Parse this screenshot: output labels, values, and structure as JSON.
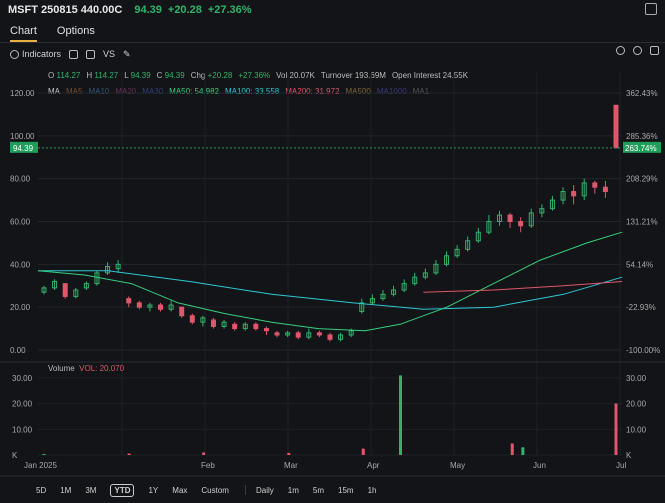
{
  "header": {
    "title": "MSFT 250815 440.00C",
    "price": "94.39",
    "change": "+20.28",
    "change_pct": "+27.36%"
  },
  "tabs": [
    "Chart",
    "Options"
  ],
  "toolbar": {
    "indicators": "Indicators",
    "vs": "VS"
  },
  "ohlc": {
    "o": "O",
    "o_val": "114.27",
    "h": "H",
    "h_val": "114.27",
    "l": "L",
    "l_val": "94.39",
    "c": "C",
    "c_val": "94.39",
    "chg": "Chg",
    "chg_val": "+20.28",
    "chg_pct": "+27.36%",
    "vol": "Vol",
    "vol_val": "20.07K",
    "turnover": "Turnover",
    "turnover_val": "193.69M",
    "oi": "Open Interest",
    "oi_val": "24.55K"
  },
  "ma_legend": [
    {
      "label": "MA",
      "color": "#c8c8c8"
    },
    {
      "label": "MA5",
      "color": "#7a4a2a"
    },
    {
      "label": "MA10",
      "color": "#2e5a7a"
    },
    {
      "label": "MA20",
      "color": "#6a2e5a"
    },
    {
      "label": "MA30",
      "color": "#2e3e7a"
    },
    {
      "label": "MA50: 54.982",
      "color": "#35d07f"
    },
    {
      "label": "MA100: 33.558",
      "color": "#2ec8d8"
    },
    {
      "label": "MA200: 31.972",
      "color": "#e0566a"
    },
    {
      "label": "MA500",
      "color": "#7a6a2e"
    },
    {
      "label": "MA1000",
      "color": "#3a3a7a"
    },
    {
      "label": "MA1",
      "color": "#555555"
    }
  ],
  "price_axis": [
    "120.00",
    "100.00",
    "80.00",
    "60.00",
    "40.00",
    "20.00",
    "0.00"
  ],
  "pct_axis": [
    "362.43%",
    "285.36%",
    "208.29%",
    "131.21%",
    "54.14%",
    "-22.93%",
    "-100.00%"
  ],
  "last_price_tag": "94.39",
  "last_pct_tag": "263.74%",
  "volume": {
    "label": "Volume",
    "vol_text": "VOL: 20.070",
    "left_axis": [
      "30.00",
      "20.00",
      "10.00",
      "K"
    ],
    "right_axis": [
      "30.00",
      "20.00",
      "10.00",
      "K"
    ]
  },
  "x_axis": [
    "Jan 2025",
    "Feb",
    "Mar",
    "Apr",
    "May",
    "Jun",
    "Jul"
  ],
  "periods": [
    "5D",
    "1M",
    "3M",
    "YTD",
    "1Y",
    "Max",
    "Custom"
  ],
  "selected_period": "YTD",
  "intervals": [
    "Daily",
    "1m",
    "5m",
    "15m",
    "1h"
  ],
  "colors": {
    "up": "#2fb36b",
    "down": "#e0566a",
    "ma50": "#35d07f",
    "ma100": "#2ec8d8",
    "ma200": "#e0566a"
  },
  "chart_data": {
    "type": "candlestick",
    "y_range": [
      0,
      120
    ],
    "volume_range_k": [
      0,
      30
    ],
    "candles": [
      {
        "x": "Jan 02",
        "o": 27,
        "c": 29,
        "h": 30,
        "l": 26
      },
      {
        "x": "Jan 06",
        "o": 29,
        "c": 32,
        "h": 33,
        "l": 28
      },
      {
        "x": "Jan 10",
        "o": 31,
        "c": 25,
        "h": 31,
        "l": 24
      },
      {
        "x": "Jan 14",
        "o": 25,
        "c": 28,
        "h": 29,
        "l": 24
      },
      {
        "x": "Jan 18",
        "o": 29,
        "c": 31,
        "h": 32,
        "l": 28
      },
      {
        "x": "Jan 22",
        "o": 31,
        "c": 36,
        "h": 37,
        "l": 30
      },
      {
        "x": "Jan 26",
        "o": 36,
        "c": 39,
        "h": 41,
        "l": 35
      },
      {
        "x": "Jan 30",
        "o": 38,
        "c": 40,
        "h": 42,
        "l": 36
      },
      {
        "x": "Feb 03",
        "o": 24,
        "c": 22,
        "h": 25,
        "l": 20
      },
      {
        "x": "Feb 07",
        "o": 22,
        "c": 20,
        "h": 23,
        "l": 19
      },
      {
        "x": "Feb 11",
        "o": 20,
        "c": 21,
        "h": 22,
        "l": 18
      },
      {
        "x": "Feb 15",
        "o": 21,
        "c": 19,
        "h": 22,
        "l": 18
      },
      {
        "x": "Feb 19",
        "o": 19,
        "c": 21,
        "h": 23,
        "l": 18
      },
      {
        "x": "Feb 23",
        "o": 20,
        "c": 16,
        "h": 20,
        "l": 15
      },
      {
        "x": "Feb 27",
        "o": 16,
        "c": 13,
        "h": 17,
        "l": 12
      },
      {
        "x": "Mar 03",
        "o": 13,
        "c": 15,
        "h": 16,
        "l": 11
      },
      {
        "x": "Mar 07",
        "o": 14,
        "c": 11,
        "h": 15,
        "l": 10
      },
      {
        "x": "Mar 11",
        "o": 11,
        "c": 13,
        "h": 14,
        "l": 10
      },
      {
        "x": "Mar 15",
        "o": 12,
        "c": 10,
        "h": 13,
        "l": 9
      },
      {
        "x": "Mar 19",
        "o": 10,
        "c": 12,
        "h": 13,
        "l": 9
      },
      {
        "x": "Mar 23",
        "o": 12,
        "c": 10,
        "h": 13,
        "l": 9
      },
      {
        "x": "Mar 27",
        "o": 10,
        "c": 9,
        "h": 11,
        "l": 7
      },
      {
        "x": "Mar 31",
        "o": 8,
        "c": 7,
        "h": 9,
        "l": 6
      },
      {
        "x": "Apr 04",
        "o": 7,
        "c": 8,
        "h": 9,
        "l": 6
      },
      {
        "x": "Apr 08",
        "o": 8,
        "c": 6,
        "h": 9,
        "l": 5
      },
      {
        "x": "Apr 12",
        "o": 6,
        "c": 8,
        "h": 10,
        "l": 5
      },
      {
        "x": "Apr 16",
        "o": 8,
        "c": 7,
        "h": 9,
        "l": 6
      },
      {
        "x": "Apr 20",
        "o": 7,
        "c": 5,
        "h": 8,
        "l": 4
      },
      {
        "x": "Apr 24",
        "o": 5,
        "c": 7,
        "h": 8,
        "l": 4
      },
      {
        "x": "Apr 28",
        "o": 7,
        "c": 9,
        "h": 10,
        "l": 6
      },
      {
        "x": "May 02",
        "o": 18,
        "c": 22,
        "h": 24,
        "l": 17
      },
      {
        "x": "May 06",
        "o": 22,
        "c": 24,
        "h": 26,
        "l": 21
      },
      {
        "x": "May 10",
        "o": 24,
        "c": 26,
        "h": 28,
        "l": 23
      },
      {
        "x": "May 14",
        "o": 26,
        "c": 28,
        "h": 30,
        "l": 25
      },
      {
        "x": "May 18",
        "o": 28,
        "c": 31,
        "h": 33,
        "l": 27
      },
      {
        "x": "May 22",
        "o": 31,
        "c": 34,
        "h": 36,
        "l": 30
      },
      {
        "x": "May 26",
        "o": 34,
        "c": 36,
        "h": 38,
        "l": 33
      },
      {
        "x": "May 30",
        "o": 36,
        "c": 40,
        "h": 42,
        "l": 35
      },
      {
        "x": "Jun 03",
        "o": 40,
        "c": 44,
        "h": 46,
        "l": 39
      },
      {
        "x": "Jun 07",
        "o": 44,
        "c": 47,
        "h": 49,
        "l": 43
      },
      {
        "x": "Jun 11",
        "o": 47,
        "c": 51,
        "h": 53,
        "l": 46
      },
      {
        "x": "Jun 15",
        "o": 51,
        "c": 55,
        "h": 57,
        "l": 50
      },
      {
        "x": "Jun 19",
        "o": 55,
        "c": 60,
        "h": 63,
        "l": 54
      },
      {
        "x": "Jun 23",
        "o": 60,
        "c": 63,
        "h": 65,
        "l": 58
      },
      {
        "x": "Jun 27",
        "o": 63,
        "c": 60,
        "h": 64,
        "l": 57
      },
      {
        "x": "Jul 01",
        "o": 60,
        "c": 58,
        "h": 62,
        "l": 55
      },
      {
        "x": "Jul 05",
        "o": 58,
        "c": 64,
        "h": 66,
        "l": 57
      },
      {
        "x": "Jul 09",
        "o": 64,
        "c": 66,
        "h": 68,
        "l": 62
      },
      {
        "x": "Jul 13",
        "o": 66,
        "c": 70,
        "h": 72,
        "l": 65
      },
      {
        "x": "Jul 17",
        "o": 70,
        "c": 74,
        "h": 76,
        "l": 68
      },
      {
        "x": "Jul 21",
        "o": 74,
        "c": 72,
        "h": 77,
        "l": 68
      },
      {
        "x": "Jul 25",
        "o": 72,
        "c": 78,
        "h": 80,
        "l": 70
      },
      {
        "x": "Jul 29",
        "o": 78,
        "c": 76,
        "h": 79,
        "l": 73
      },
      {
        "x": "Aug 01",
        "o": 76,
        "c": 74,
        "h": 79,
        "l": 71
      },
      {
        "x": "Aug 05",
        "o": 114.27,
        "c": 94.39,
        "h": 114.27,
        "l": 94.39
      }
    ],
    "volume_k": [
      {
        "x": "Jan 02",
        "v": 0.4,
        "up": true
      },
      {
        "x": "Feb 03",
        "v": 0.6,
        "up": false
      },
      {
        "x": "Mar 03",
        "v": 1.0,
        "up": false
      },
      {
        "x": "Apr 04",
        "v": 0.8,
        "up": false
      },
      {
        "x": "May 02",
        "v": 2.5,
        "up": false
      },
      {
        "x": "May 16",
        "v": 31,
        "up": true
      },
      {
        "x": "Jun 27",
        "v": 4.5,
        "up": false
      },
      {
        "x": "Jul 01",
        "v": 3.0,
        "up": true
      },
      {
        "x": "Aug 05",
        "v": 20.07,
        "up": false
      }
    ],
    "ma50": [
      [
        0,
        37
      ],
      [
        0.08,
        35
      ],
      [
        0.16,
        31
      ],
      [
        0.24,
        22
      ],
      [
        0.32,
        17
      ],
      [
        0.4,
        13
      ],
      [
        0.48,
        10
      ],
      [
        0.56,
        9
      ],
      [
        0.62,
        12
      ],
      [
        0.7,
        20
      ],
      [
        0.78,
        31
      ],
      [
        0.86,
        42
      ],
      [
        0.94,
        50
      ],
      [
        1,
        55
      ]
    ],
    "ma100": [
      [
        0,
        37
      ],
      [
        0.12,
        37
      ],
      [
        0.26,
        32
      ],
      [
        0.4,
        26
      ],
      [
        0.54,
        22
      ],
      [
        0.66,
        19
      ],
      [
        0.78,
        20
      ],
      [
        0.9,
        26
      ],
      [
        1,
        34
      ]
    ],
    "ma200": [
      [
        0.66,
        27
      ],
      [
        0.78,
        28
      ],
      [
        0.9,
        30
      ],
      [
        1,
        32
      ]
    ]
  }
}
